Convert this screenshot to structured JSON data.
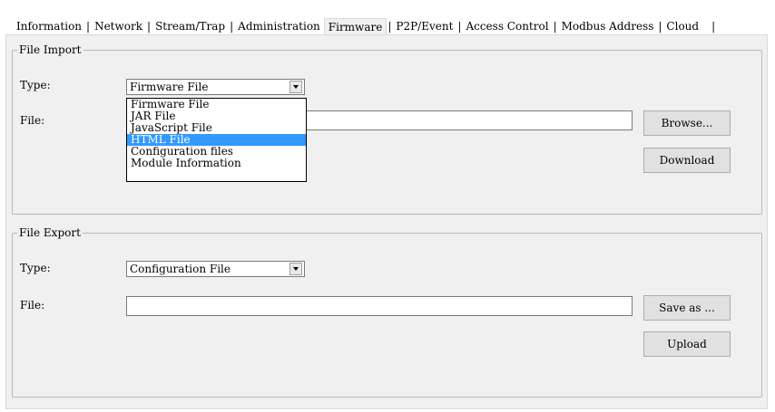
{
  "tabs": [
    {
      "label": "Information",
      "active": false
    },
    {
      "label": "Network",
      "active": false
    },
    {
      "label": "Stream/Trap",
      "active": false
    },
    {
      "label": "Administration",
      "active": false
    },
    {
      "label": "Firmware",
      "active": true
    },
    {
      "label": "P2P/Event",
      "active": false
    },
    {
      "label": "Access Control",
      "active": false
    },
    {
      "label": "Modbus Address",
      "active": false
    },
    {
      "label": "Cloud",
      "active": false
    }
  ],
  "file_import": {
    "legend": "File Import",
    "type_label": "Type:",
    "type_value": "Firmware File",
    "file_label": "File:",
    "file_value": "",
    "browse_label": "Browse...",
    "download_label": "Download",
    "dropdown_options": [
      "Firmware File",
      "JAR File",
      "JavaScript File",
      "HTML File",
      "Configuration files",
      "Module Information"
    ],
    "dropdown_selected_index": 3
  },
  "file_export": {
    "legend": "File Export",
    "type_label": "Type:",
    "type_value": "Configuration File",
    "file_label": "File:",
    "file_value": "",
    "save_label": "Save as ...",
    "upload_label": "Upload"
  },
  "colors": {
    "selection": "#3399ff",
    "panel": "#f0f0f0"
  }
}
